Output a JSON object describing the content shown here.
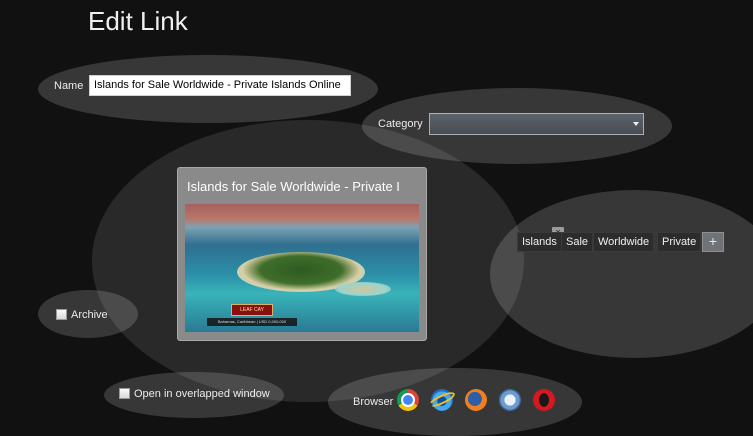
{
  "window": {
    "title": "Edit Link"
  },
  "name_field": {
    "label": "Name",
    "value": "Islands for Sale Worldwide - Private Islands Online"
  },
  "category_field": {
    "label": "Category",
    "value": ""
  },
  "preview": {
    "title": "Islands for Sale Worldwide - Private I",
    "image_badge": "LEAF CAY",
    "image_caption": "Bahamas, Caribbean | USD 0,000,000"
  },
  "tags": {
    "items": [
      "Islands",
      "Sale",
      "Worldwide",
      "Private"
    ],
    "remove_symbol": "×",
    "add_symbol": "+"
  },
  "archive": {
    "label": "Archive",
    "checked": false
  },
  "overlapped_window": {
    "label": "Open in overlapped window",
    "checked": false
  },
  "browser": {
    "label": "Browser",
    "icons": [
      "chrome-icon",
      "internet-explorer-icon",
      "firefox-icon",
      "safari-icon",
      "opera-icon"
    ]
  }
}
